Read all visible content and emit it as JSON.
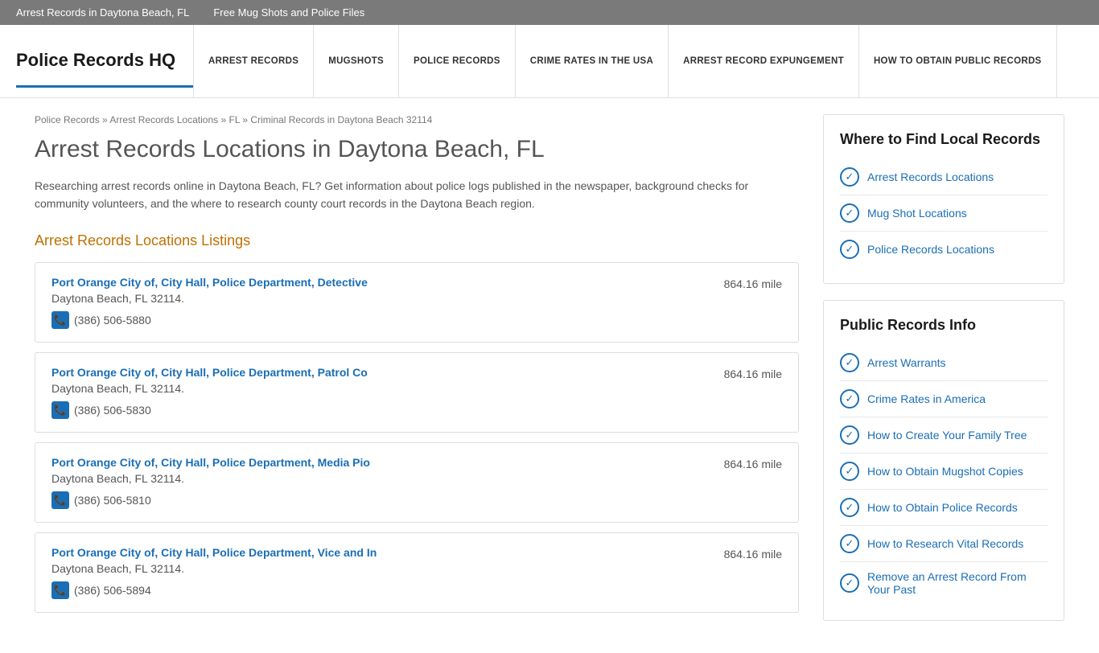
{
  "topbar": {
    "links": [
      {
        "label": "Arrest Records in Daytona Beach, FL",
        "href": "#"
      },
      {
        "label": "Free Mug Shots and Police Files",
        "href": "#"
      }
    ]
  },
  "header": {
    "logo": "Police Records HQ",
    "nav": [
      {
        "label": "ARREST RECORDS"
      },
      {
        "label": "MUGSHOTS"
      },
      {
        "label": "POLICE RECORDS"
      },
      {
        "label": "CRIME RATES IN THE USA"
      },
      {
        "label": "ARREST RECORD EXPUNGEMENT"
      },
      {
        "label": "HOW TO OBTAIN PUBLIC RECORDS"
      }
    ]
  },
  "breadcrumb": {
    "items": [
      {
        "label": "Police Records",
        "href": "#"
      },
      {
        "label": "Arrest Records Locations",
        "href": "#"
      },
      {
        "label": "FL",
        "href": "#"
      },
      {
        "label": "Criminal Records in Daytona Beach 32114",
        "href": "#"
      }
    ]
  },
  "page": {
    "title": "Arrest Records Locations in Daytona Beach, FL",
    "description": "Researching arrest records online in Daytona Beach, FL? Get information about police logs published in the newspaper, background checks for community volunteers, and the where to research county court records in the Daytona Beach region.",
    "section_heading": "Arrest Records Locations Listings"
  },
  "listings": [
    {
      "name": "Port Orange City of, City Hall, Police Department, Detective",
      "address": "Daytona Beach, FL 32114.",
      "phone": "(386) 506-5880",
      "distance": "864.16 mile"
    },
    {
      "name": "Port Orange City of, City Hall, Police Department, Patrol Co",
      "address": "Daytona Beach, FL 32114.",
      "phone": "(386) 506-5830",
      "distance": "864.16 mile"
    },
    {
      "name": "Port Orange City of, City Hall, Police Department, Media Pio",
      "address": "Daytona Beach, FL 32114.",
      "phone": "(386) 506-5810",
      "distance": "864.16 mile"
    },
    {
      "name": "Port Orange City of, City Hall, Police Department, Vice and In",
      "address": "Daytona Beach, FL 32114.",
      "phone": "(386) 506-5894",
      "distance": "864.16 mile"
    }
  ],
  "sidebar": {
    "where_to_find": {
      "title": "Where to Find Local Records",
      "links": [
        {
          "label": "Arrest Records Locations"
        },
        {
          "label": "Mug Shot Locations"
        },
        {
          "label": "Police Records Locations"
        }
      ]
    },
    "public_records": {
      "title": "Public Records Info",
      "links": [
        {
          "label": "Arrest Warrants"
        },
        {
          "label": "Crime Rates in America"
        },
        {
          "label": "How to Create Your Family Tree"
        },
        {
          "label": "How to Obtain Mugshot Copies"
        },
        {
          "label": "How to Obtain Police Records"
        },
        {
          "label": "How to Research Vital Records"
        },
        {
          "label": "Remove an Arrest Record From Your Past"
        }
      ]
    }
  }
}
